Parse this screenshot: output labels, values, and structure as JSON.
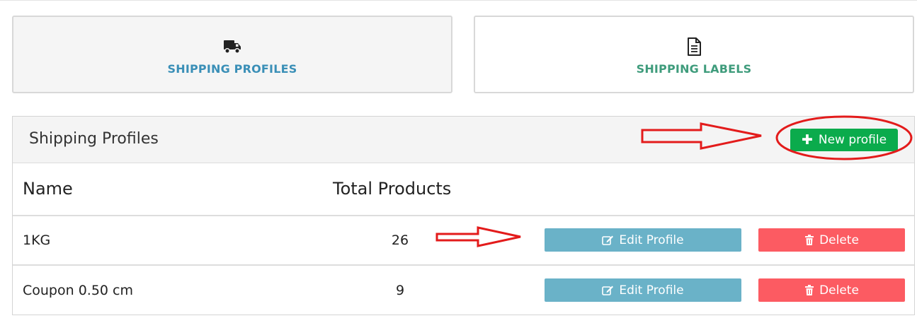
{
  "tabs": [
    {
      "label": "SHIPPING PROFILES",
      "icon": "truck-icon",
      "active": true
    },
    {
      "label": "SHIPPING LABELS",
      "icon": "document-icon",
      "active": false
    }
  ],
  "panel": {
    "title": "Shipping Profiles",
    "new_button_label": "New profile"
  },
  "table": {
    "columns": [
      "Name",
      "Total Products"
    ],
    "rows": [
      {
        "name": "1KG",
        "total": "26",
        "edit_label": "Edit Profile",
        "delete_label": "Delete"
      },
      {
        "name": "Coupon 0.50 cm",
        "total": "9",
        "edit_label": "Edit Profile",
        "delete_label": "Delete"
      }
    ]
  },
  "colors": {
    "accent_blue": "#3a8fb7",
    "accent_green": "#3f9c7c",
    "new_button": "#0bab4c",
    "edit_button": "#6ab2c8",
    "delete_button": "#fc5b62",
    "annotation": "#e31b1b"
  }
}
